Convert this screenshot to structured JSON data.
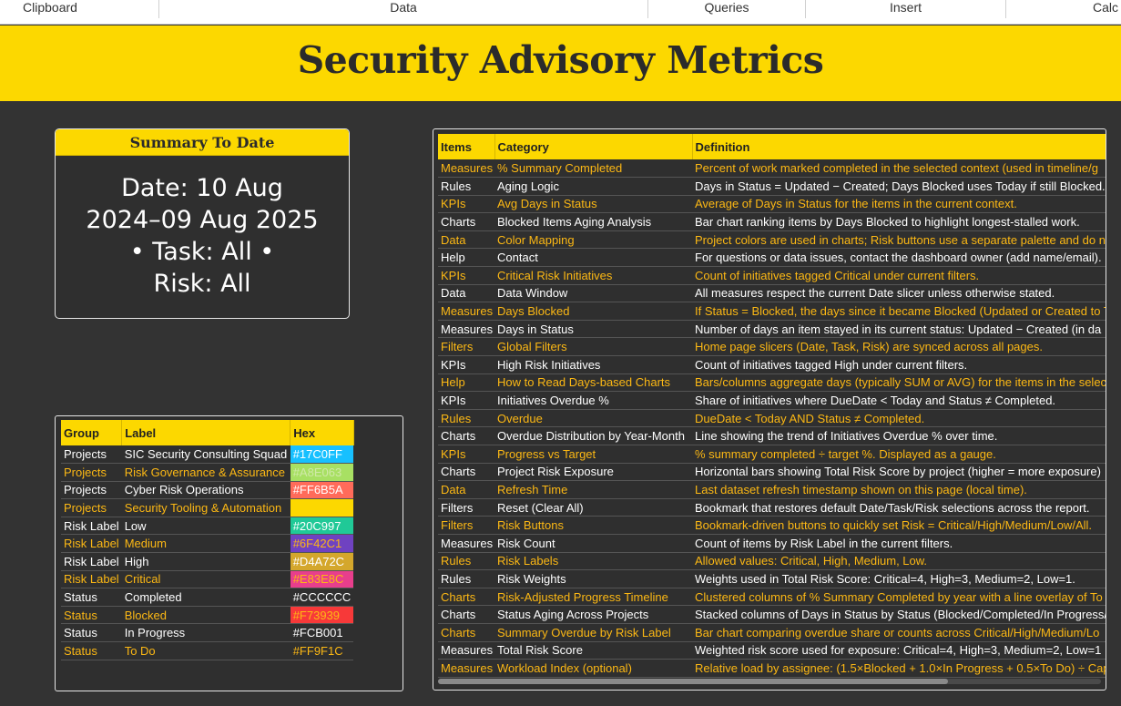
{
  "ribbon": {
    "groups": [
      "Clipboard",
      "Data",
      "Queries",
      "Insert",
      "Calc"
    ]
  },
  "banner": {
    "title": "Security Advisory Metrics"
  },
  "summary": {
    "heading": "Summary To Date",
    "lines": [
      "Date: 10 Aug",
      "2024–09 Aug 2025",
      "•  Task: All  •",
      "Risk: All"
    ]
  },
  "color_table": {
    "headers": [
      "Group",
      "Label",
      "Hex"
    ],
    "rows": [
      {
        "group": "Projects",
        "label": "SIC Security Consulting Squad",
        "hex": "#17C0FF",
        "color": "#17C0FF"
      },
      {
        "group": "Projects",
        "label": "Risk Governance & Assurance",
        "hex": "#A8E063",
        "color": "#A8E063"
      },
      {
        "group": "Projects",
        "label": "Cyber Risk Operations",
        "hex": "#FF6B5A",
        "color": "#FF6B5A"
      },
      {
        "group": "Projects",
        "label": "Security Tooling & Automation",
        "hex": "",
        "color": "#FCD800"
      },
      {
        "group": "Risk Label",
        "label": "Low",
        "hex": "#20C997",
        "color": "#20C997"
      },
      {
        "group": "Risk Label",
        "label": "Medium",
        "hex": "#6F42C1",
        "color": "#6F42C1"
      },
      {
        "group": "Risk Label",
        "label": "High",
        "hex": "#D4A72C",
        "color": "#D4A72C"
      },
      {
        "group": "Risk Label",
        "label": "Critical",
        "hex": "#E83E8C",
        "color": "#E83E8C"
      },
      {
        "group": "Status",
        "label": "Completed",
        "hex": "#CCCCCC",
        "color": ""
      },
      {
        "group": "Status",
        "label": "Blocked",
        "hex": "#F73939",
        "color": "#F73939"
      },
      {
        "group": "Status",
        "label": "In Progress",
        "hex": "#FCB001",
        "color": ""
      },
      {
        "group": "Status",
        "label": "To Do",
        "hex": "#FF9F1C",
        "color": ""
      }
    ]
  },
  "definitions_table": {
    "headers": [
      "Items",
      "Category",
      "Definition"
    ],
    "rows": [
      {
        "item": "Measures",
        "category": "% Summary Completed",
        "definition": "Percent of work marked completed in the selected context (used in timeline/g"
      },
      {
        "item": "Rules",
        "category": "Aging Logic",
        "definition": "Days in Status = Updated − Created; Days Blocked uses Today if still Blocked."
      },
      {
        "item": "KPIs",
        "category": "Avg Days in Status",
        "definition": "Average of Days in Status for the items in the current context."
      },
      {
        "item": "Charts",
        "category": "Blocked Items Aging Analysis",
        "definition": "Bar chart ranking items by Days Blocked to highlight longest-stalled work."
      },
      {
        "item": "Data",
        "category": "Color Mapping",
        "definition": "Project colors are used in charts; Risk buttons use a separate palette and do n"
      },
      {
        "item": "Help",
        "category": "Contact",
        "definition": "For questions or data issues, contact the dashboard owner (add name/email)."
      },
      {
        "item": "KPIs",
        "category": "Critical Risk Initiatives",
        "definition": "Count of initiatives tagged Critical under current filters."
      },
      {
        "item": "Data",
        "category": "Data Window",
        "definition": "All measures respect the current Date slicer unless otherwise stated."
      },
      {
        "item": "Measures",
        "category": "Days Blocked",
        "definition": "If Status = Blocked, the days since it became Blocked (Updated or Created to T"
      },
      {
        "item": "Measures",
        "category": "Days in Status",
        "definition": "Number of days an item stayed in its current status: Updated − Created (in da"
      },
      {
        "item": "Filters",
        "category": "Global Filters",
        "definition": "Home page slicers (Date, Task, Risk) are synced across all pages."
      },
      {
        "item": "KPIs",
        "category": "High Risk Initiatives",
        "definition": "Count of initiatives tagged High under current filters."
      },
      {
        "item": "Help",
        "category": "How to Read Days-based Charts",
        "definition": "Bars/columns aggregate days (typically SUM or AVG) for the items in the selec"
      },
      {
        "item": "KPIs",
        "category": "Initiatives Overdue %",
        "definition": "Share of initiatives where DueDate < Today and Status ≠ Completed."
      },
      {
        "item": "Rules",
        "category": "Overdue",
        "definition": "DueDate < Today AND Status ≠ Completed."
      },
      {
        "item": "Charts",
        "category": "Overdue Distribution by Year-Month",
        "definition": "Line showing the trend of Initiatives Overdue % over time."
      },
      {
        "item": "KPIs",
        "category": "Progress vs Target",
        "definition": "% summary completed ÷ target %. Displayed as a gauge."
      },
      {
        "item": "Charts",
        "category": "Project Risk Exposure",
        "definition": "Horizontal bars showing Total Risk Score by project (higher = more exposure)"
      },
      {
        "item": "Data",
        "category": "Refresh Time",
        "definition": "Last dataset refresh timestamp shown on this page (local time)."
      },
      {
        "item": "Filters",
        "category": "Reset (Clear All)",
        "definition": "Bookmark that restores default Date/Task/Risk selections across the report."
      },
      {
        "item": "Filters",
        "category": "Risk Buttons",
        "definition": "Bookmark-driven buttons to quickly set Risk = Critical/High/Medium/Low/All."
      },
      {
        "item": "Measures",
        "category": "Risk Count",
        "definition": "Count of items by Risk Label in the current filters."
      },
      {
        "item": "Rules",
        "category": "Risk Labels",
        "definition": "Allowed values: Critical, High, Medium, Low."
      },
      {
        "item": "Rules",
        "category": "Risk Weights",
        "definition": "Weights used in Total Risk Score: Critical=4, High=3, Medium=2, Low=1."
      },
      {
        "item": "Charts",
        "category": "Risk-Adjusted Progress Timeline",
        "definition": "Clustered columns of % Summary Completed by year with a line overlay of To"
      },
      {
        "item": "Charts",
        "category": "Status Aging Across Projects",
        "definition": "Stacked columns of Days in Status by Status (Blocked/Completed/In Progress/"
      },
      {
        "item": "Charts",
        "category": "Summary Overdue by Risk Label",
        "definition": "Bar chart comparing overdue share or counts across Critical/High/Medium/Lo"
      },
      {
        "item": "Measures",
        "category": "Total Risk Score",
        "definition": "Weighted risk score used for exposure: Critical=4, High=3, Medium=2, Low=1"
      },
      {
        "item": "Measures",
        "category": "Workload Index (optional)",
        "definition": "Relative load by assignee: (1.5×Blocked + 1.0×In Progress + 0.5×To Do) ÷ Cap"
      }
    ]
  },
  "colors": {
    "banner": "#FCD800",
    "background": "#333333",
    "accent_text": "#FCB814"
  }
}
